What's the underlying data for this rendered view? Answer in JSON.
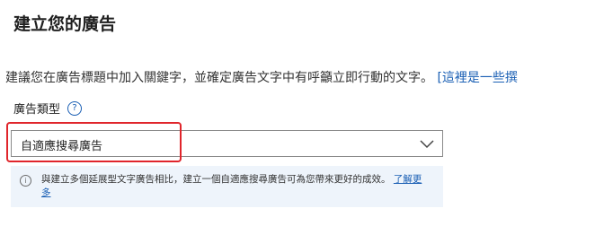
{
  "header": {
    "title": "建立您的廣告"
  },
  "description": {
    "text": "建議您在廣告標題中加入關鍵字，並確定廣告文字中有呼籲立即行動的文字。 ",
    "link_text": "[這裡是一些撰"
  },
  "ad_type": {
    "label": "廣告類型",
    "help_icon": "?",
    "selected_value": "自適應搜尋廣告"
  },
  "info_box": {
    "icon": "i",
    "text": "與建立多個延展型文字廣告相比，建立一個自適應搜尋廣告可為您帶來更好的成效。 ",
    "link_text": "了解更多"
  },
  "colors": {
    "link": "#1a5fb4",
    "highlight_border": "#e0252b",
    "info_background": "#eef4fb"
  }
}
